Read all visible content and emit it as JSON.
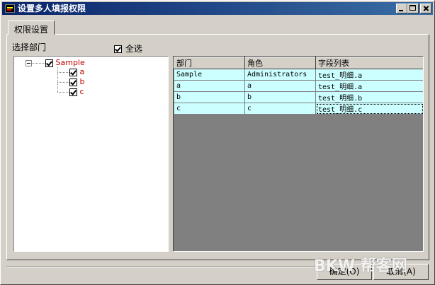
{
  "window": {
    "title": "设置多人填报权限"
  },
  "tabs": [
    {
      "label": "权限设置"
    }
  ],
  "departments": {
    "label": "选择部门",
    "select_all_label": "全选",
    "tree": {
      "root": {
        "label": "Sample",
        "checked": true
      },
      "children": [
        {
          "label": "a",
          "checked": true
        },
        {
          "label": "b",
          "checked": true
        },
        {
          "label": "c",
          "checked": true
        }
      ]
    }
  },
  "grid": {
    "columns": [
      "部门",
      "角色",
      "字段列表"
    ],
    "rows": [
      [
        "Sample",
        "Administrators",
        "test_明细.a"
      ],
      [
        "a",
        "a",
        "test_明细.a"
      ],
      [
        "b",
        "b",
        "test_明细.b"
      ],
      [
        "c",
        "c",
        "test_明细.c"
      ]
    ]
  },
  "buttons": {
    "ok": "确定(O)",
    "cancel": "取消(A)"
  },
  "watermark": "BKW 帮客网",
  "colors": {
    "title_bar": "#0a246a",
    "grid_row": "#ccffff",
    "tree_text": "#c00000"
  }
}
